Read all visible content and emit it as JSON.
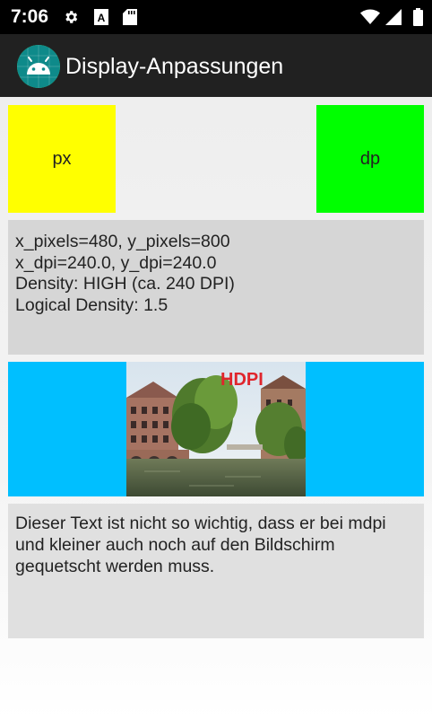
{
  "status_bar": {
    "time": "7:06",
    "left_icons": [
      "gear-icon",
      "keyboard-a-icon",
      "sd-card-icon"
    ],
    "right_icons": [
      "wifi-icon",
      "signal-icon",
      "battery-icon"
    ]
  },
  "app_bar": {
    "title": "Display-Anpassungen",
    "logo_icon": "android-logo-icon",
    "color": "#212121"
  },
  "boxes": {
    "px": {
      "label": "px",
      "color": "#ffff00"
    },
    "dp": {
      "label": "dp",
      "color": "#00ff00"
    }
  },
  "info": {
    "line1": "x_pixels=480, y_pixels=800",
    "line2": "x_dpi=240.0, y_dpi=240.0",
    "line3": "Density: HIGH (ca. 240 DPI)",
    "line4": "Logical Density: 1.5"
  },
  "image_panel": {
    "label": "HDPI",
    "background": "#00bfff"
  },
  "paragraph": {
    "text": "Dieser Text ist nicht so wichtig, dass er bei mdpi und kleiner auch noch auf den Bildschirm gequetscht werden muss."
  }
}
